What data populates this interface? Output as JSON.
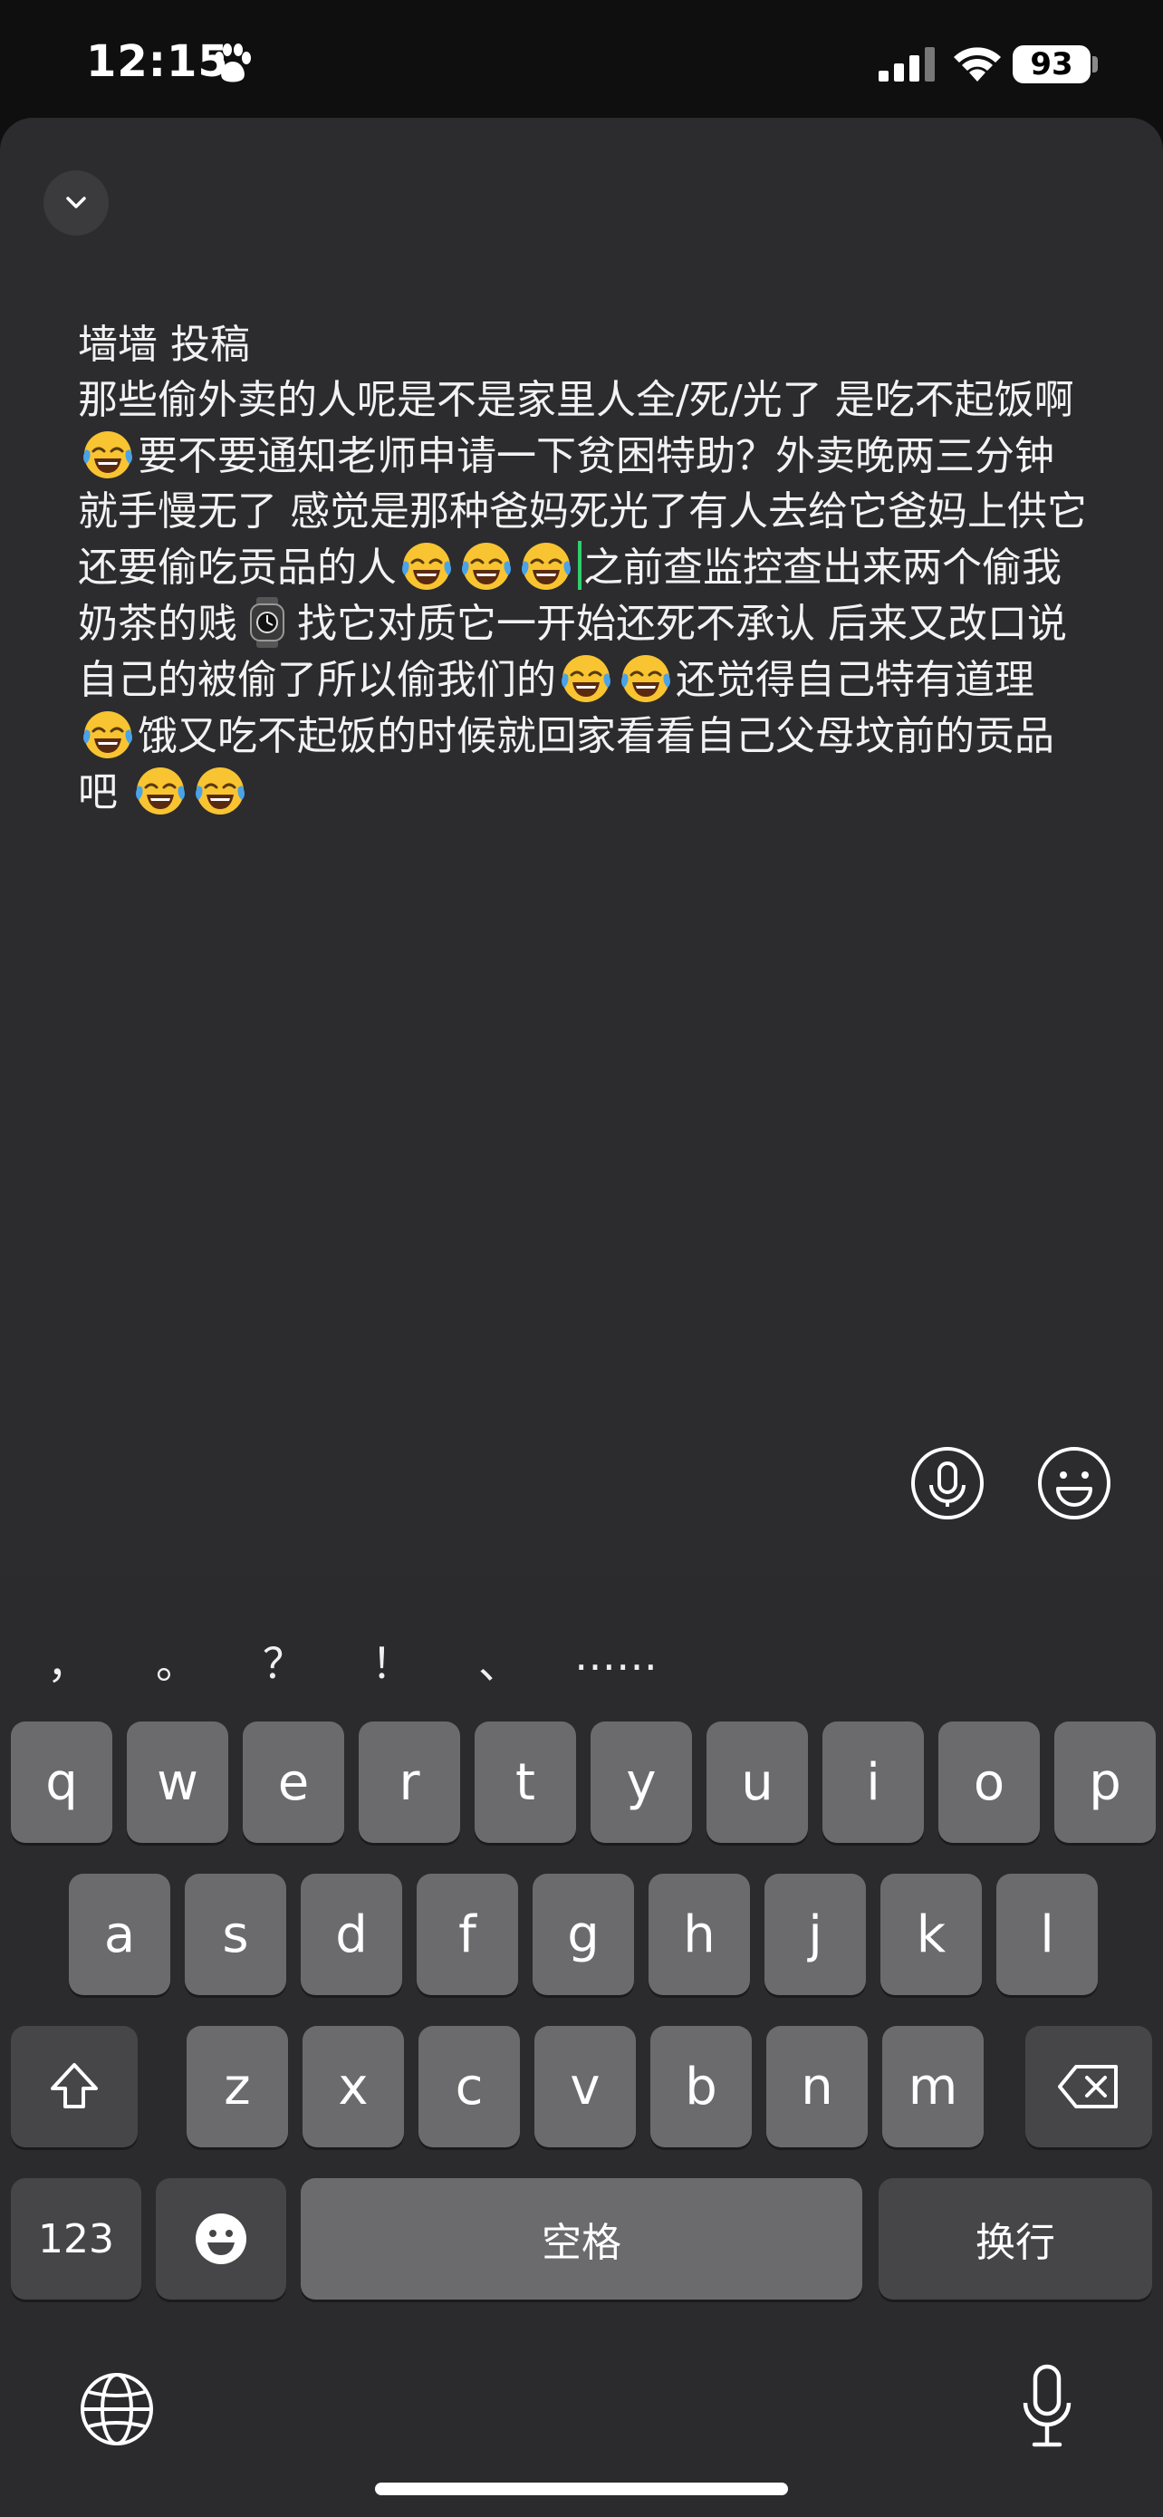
{
  "status": {
    "time": "12:15",
    "battery": "93"
  },
  "editor": {
    "segments": [
      {
        "t": "text",
        "v": "墙墙 投稿\n那些偷外卖的人呢是不是家里人全/死/光了 是吃不起饭啊"
      },
      {
        "t": "emoji",
        "v": "laugh"
      },
      {
        "t": "text",
        "v": "要不要通知老师申请一下贫困特助？外卖晚两三分钟就手慢无了 感觉是那种爸妈死光了有人去给它爸妈上供它还要偷吃贡品的人"
      },
      {
        "t": "emoji",
        "v": "laugh"
      },
      {
        "t": "emoji",
        "v": "laugh"
      },
      {
        "t": "emoji",
        "v": "laugh"
      },
      {
        "t": "caret"
      },
      {
        "t": "text",
        "v": "之前查监控查出来两个偷我奶茶的贱"
      },
      {
        "t": "emoji",
        "v": "watch"
      },
      {
        "t": "text",
        "v": "找它对质它一开始还死不承认 后来又改口说自己的被偷了所以偷我们的"
      },
      {
        "t": "emoji",
        "v": "laugh"
      },
      {
        "t": "emoji",
        "v": "laugh"
      },
      {
        "t": "text",
        "v": "还觉得自己特有道理"
      },
      {
        "t": "emoji",
        "v": "laugh"
      },
      {
        "t": "text",
        "v": "饿又吃不起饭的时候就回家看看自己父母坟前的贡品吧 "
      },
      {
        "t": "emoji",
        "v": "laugh"
      },
      {
        "t": "emoji",
        "v": "laugh"
      }
    ]
  },
  "keyboard": {
    "punctuation": [
      "，",
      "。",
      "？",
      "！",
      "、",
      "……"
    ],
    "row1": [
      "q",
      "w",
      "e",
      "r",
      "t",
      "y",
      "u",
      "i",
      "o",
      "p"
    ],
    "row2": [
      "a",
      "s",
      "d",
      "f",
      "g",
      "h",
      "j",
      "k",
      "l"
    ],
    "row3": [
      "z",
      "x",
      "c",
      "v",
      "b",
      "n",
      "m"
    ],
    "numbers_label": "123",
    "space_label": "空格",
    "return_label": "换行"
  },
  "colors": {
    "caret": "#2fd06a",
    "sheet": "#2c2c2e",
    "key": "#6b6b6d",
    "key_dark": "#464648"
  },
  "icons": [
    "paw-icon",
    "signal-icon",
    "wifi-icon",
    "chevron-down-icon",
    "mic-icon",
    "emoji-face-icon",
    "shift-icon",
    "backspace-icon",
    "emoji-key-icon",
    "globe-icon",
    "dictation-mic-icon"
  ]
}
